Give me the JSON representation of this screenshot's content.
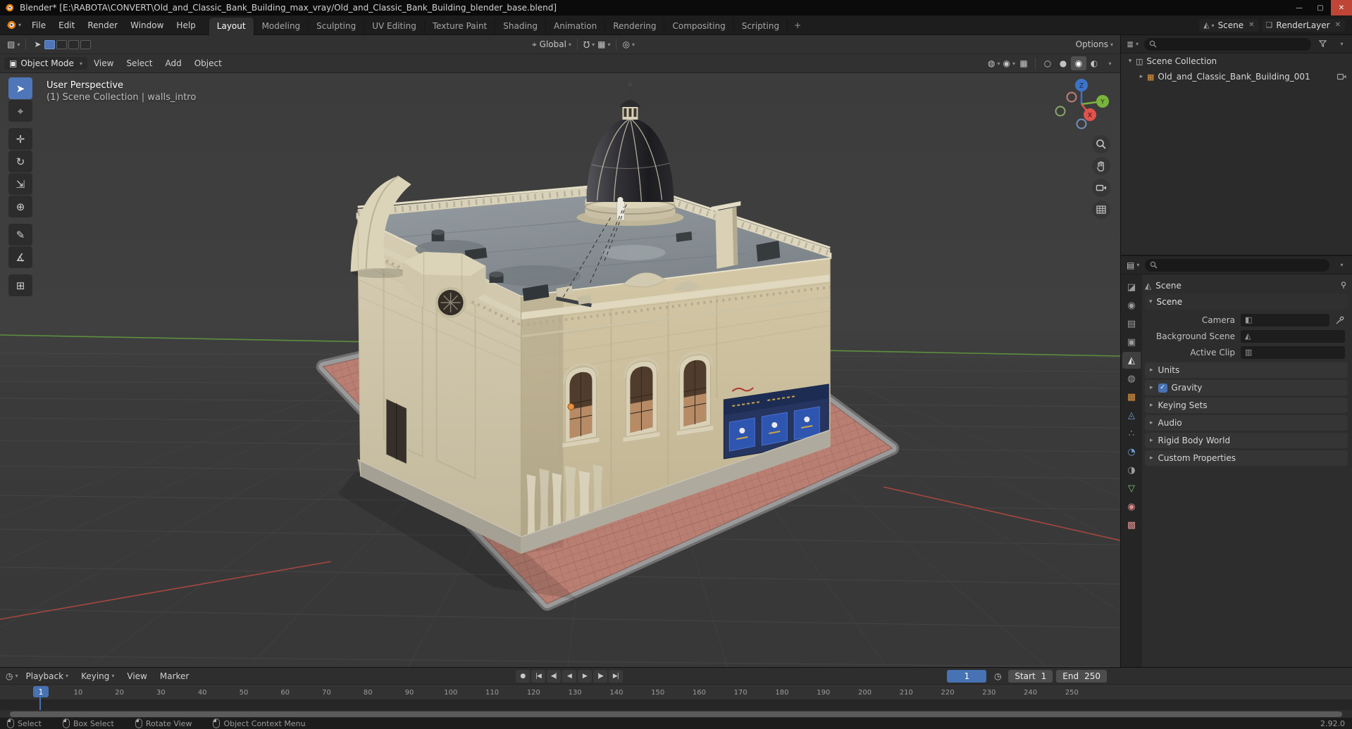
{
  "colors": {
    "accent": "#4772b3",
    "axis_x": "#a6473f",
    "axis_y": "#5d8f3e",
    "object_orange": "#e2963f"
  },
  "titlebar": {
    "app_title": "Blender* [E:\\RABOTA\\CONVERT\\Old_and_Classic_Bank_Building_max_vray/Old_and_Classic_Bank_Building_blender_base.blend]",
    "minimize": "—",
    "maximize": "▢",
    "close": "✕"
  },
  "topbar": {
    "menus": [
      "File",
      "Edit",
      "Render",
      "Window",
      "Help"
    ],
    "workspaces": [
      {
        "label": "Layout",
        "active": true
      },
      {
        "label": "Modeling"
      },
      {
        "label": "Sculpting"
      },
      {
        "label": "UV Editing"
      },
      {
        "label": "Texture Paint"
      },
      {
        "label": "Shading"
      },
      {
        "label": "Animation"
      },
      {
        "label": "Rendering"
      },
      {
        "label": "Compositing"
      },
      {
        "label": "Scripting"
      }
    ],
    "add_workspace": "+",
    "scene_name": "Scene",
    "view_layer_name": "RenderLayer"
  },
  "tool_settings": {
    "editor_icon": "▧",
    "active_tool_icon": "➤",
    "select_modes": [
      {
        "active": true
      },
      {},
      {},
      {}
    ],
    "orientation_icon": "⌖",
    "orientation_label": "Global",
    "magnet_icon": "Ω",
    "snap_icon": "▦",
    "proportional_icon": "◎",
    "options_label": "Options"
  },
  "view_header": {
    "mode_icon": "▣",
    "mode": "Object Mode",
    "menus": [
      "View",
      "Select",
      "Add",
      "Object"
    ],
    "right_icons": [
      {
        "name": "show-gizmo",
        "glyph": "◍",
        "dd": true
      },
      {
        "name": "show-overlays",
        "glyph": "◉",
        "dd": true
      },
      {
        "name": "toggle-xray",
        "glyph": "▦"
      }
    ],
    "shading_modes": [
      {
        "name": "wireframe",
        "glyph": "○"
      },
      {
        "name": "solid",
        "glyph": "●"
      },
      {
        "name": "material-preview",
        "glyph": "◉",
        "active": true
      },
      {
        "name": "rendered",
        "glyph": "◐"
      }
    ]
  },
  "viewport": {
    "overlay_line1": "User Perspective",
    "overlay_line2": "(1) Scene Collection | walls_intro",
    "axis_labels": {
      "x": "X",
      "y": "Y",
      "z": "Z"
    }
  },
  "toolbar": {
    "tools": [
      {
        "name": "select-box",
        "glyph": "➤",
        "active": true
      },
      {
        "name": "cursor",
        "glyph": "⌖"
      },
      {
        "name": "move",
        "glyph": "✛",
        "gap": true
      },
      {
        "name": "rotate",
        "glyph": "↻"
      },
      {
        "name": "scale",
        "glyph": "⇲"
      },
      {
        "name": "transform",
        "glyph": "⊕"
      },
      {
        "name": "annotate",
        "glyph": "✎",
        "gap": true
      },
      {
        "name": "measure",
        "glyph": "∡"
      },
      {
        "name": "add-cube",
        "glyph": "⊞",
        "gap": true
      }
    ]
  },
  "outliner": {
    "rows": [
      {
        "label": "Scene Collection",
        "pad": "2px",
        "icon_glyph": "◫",
        "icon_color": "#c8c8c8",
        "expanded": true
      },
      {
        "label": "Old_and_Classic_Bank_Building_001",
        "pad": "18px",
        "icon_glyph": "▦",
        "icon_color": "#e2963f",
        "camera": true
      }
    ]
  },
  "properties": {
    "tabs": [
      {
        "name": "tool",
        "glyph": "◪",
        "color": "#9c9c9c"
      },
      {
        "name": "render",
        "glyph": "◉",
        "color": "#9c9c9c"
      },
      {
        "name": "output",
        "glyph": "▤",
        "color": "#9c9c9c"
      },
      {
        "name": "view-layer",
        "glyph": "▣",
        "color": "#9c9c9c"
      },
      {
        "name": "scene",
        "glyph": "◭",
        "color": "#e0e0e0",
        "active": true
      },
      {
        "name": "world",
        "glyph": "◍",
        "color": "#9c9c9c"
      },
      {
        "name": "object",
        "glyph": "▦",
        "color": "#e2963f"
      },
      {
        "name": "modifiers",
        "glyph": "◬",
        "color": "#6f9bd1"
      },
      {
        "name": "particles",
        "glyph": "∴",
        "color": "#6f9bd1"
      },
      {
        "name": "physics",
        "glyph": "◔",
        "color": "#6f9bd1"
      },
      {
        "name": "constraints",
        "glyph": "◑",
        "color": "#9c9c9c"
      },
      {
        "name": "object-data",
        "glyph": "▽",
        "color": "#7ec47e"
      },
      {
        "name": "material",
        "glyph": "◉",
        "color": "#d98c8c"
      },
      {
        "name": "texture",
        "glyph": "▩",
        "color": "#d98c8c"
      }
    ],
    "breadcrumb_icon": "◭",
    "breadcrumb": "Scene",
    "scene_panel_title": "Scene",
    "fields": [
      {
        "label": "Camera",
        "glyph": "◧",
        "eyedropper": true
      },
      {
        "label": "Background Scene",
        "glyph": "◭"
      },
      {
        "label": "Active Clip",
        "glyph": "▥"
      }
    ],
    "panels": [
      {
        "label": "Units"
      },
      {
        "label": "Gravity",
        "checkbox": true
      },
      {
        "label": "Keying Sets"
      },
      {
        "label": "Audio"
      },
      {
        "label": "Rigid Body World"
      },
      {
        "label": "Custom Properties"
      }
    ]
  },
  "timeline": {
    "editor_icon": "◷",
    "menus": [
      {
        "label": "Playback",
        "dd": true
      },
      {
        "label": "Keying",
        "dd": true
      },
      {
        "label": "View"
      },
      {
        "label": "Marker"
      }
    ],
    "transport": [
      {
        "name": "record",
        "glyph": "●"
      },
      {
        "name": "jump-start",
        "glyph": "|◀"
      },
      {
        "name": "key-prev",
        "glyph": "◀|"
      },
      {
        "name": "play-reverse",
        "glyph": "◀"
      },
      {
        "name": "play",
        "glyph": "▶"
      },
      {
        "name": "key-next",
        "glyph": "|▶"
      },
      {
        "name": "jump-end",
        "glyph": "▶|"
      }
    ],
    "frame_current": "1",
    "clock_icon": "◷",
    "start_label": "Start",
    "start_value": "1",
    "end_label": "End",
    "end_value": "250",
    "ticks": [
      "1",
      "10",
      "20",
      "30",
      "40",
      "50",
      "60",
      "70",
      "80",
      "90",
      "100",
      "110",
      "120",
      "130",
      "140",
      "150",
      "160",
      "170",
      "180",
      "190",
      "200",
      "210",
      "220",
      "230",
      "240",
      "250"
    ]
  },
  "statusbar": {
    "hints": [
      {
        "label": "Select"
      },
      {
        "label": "Box Select"
      },
      {
        "label": "Rotate View"
      },
      {
        "label": "Object Context Menu"
      }
    ],
    "version": "2.92.0"
  }
}
